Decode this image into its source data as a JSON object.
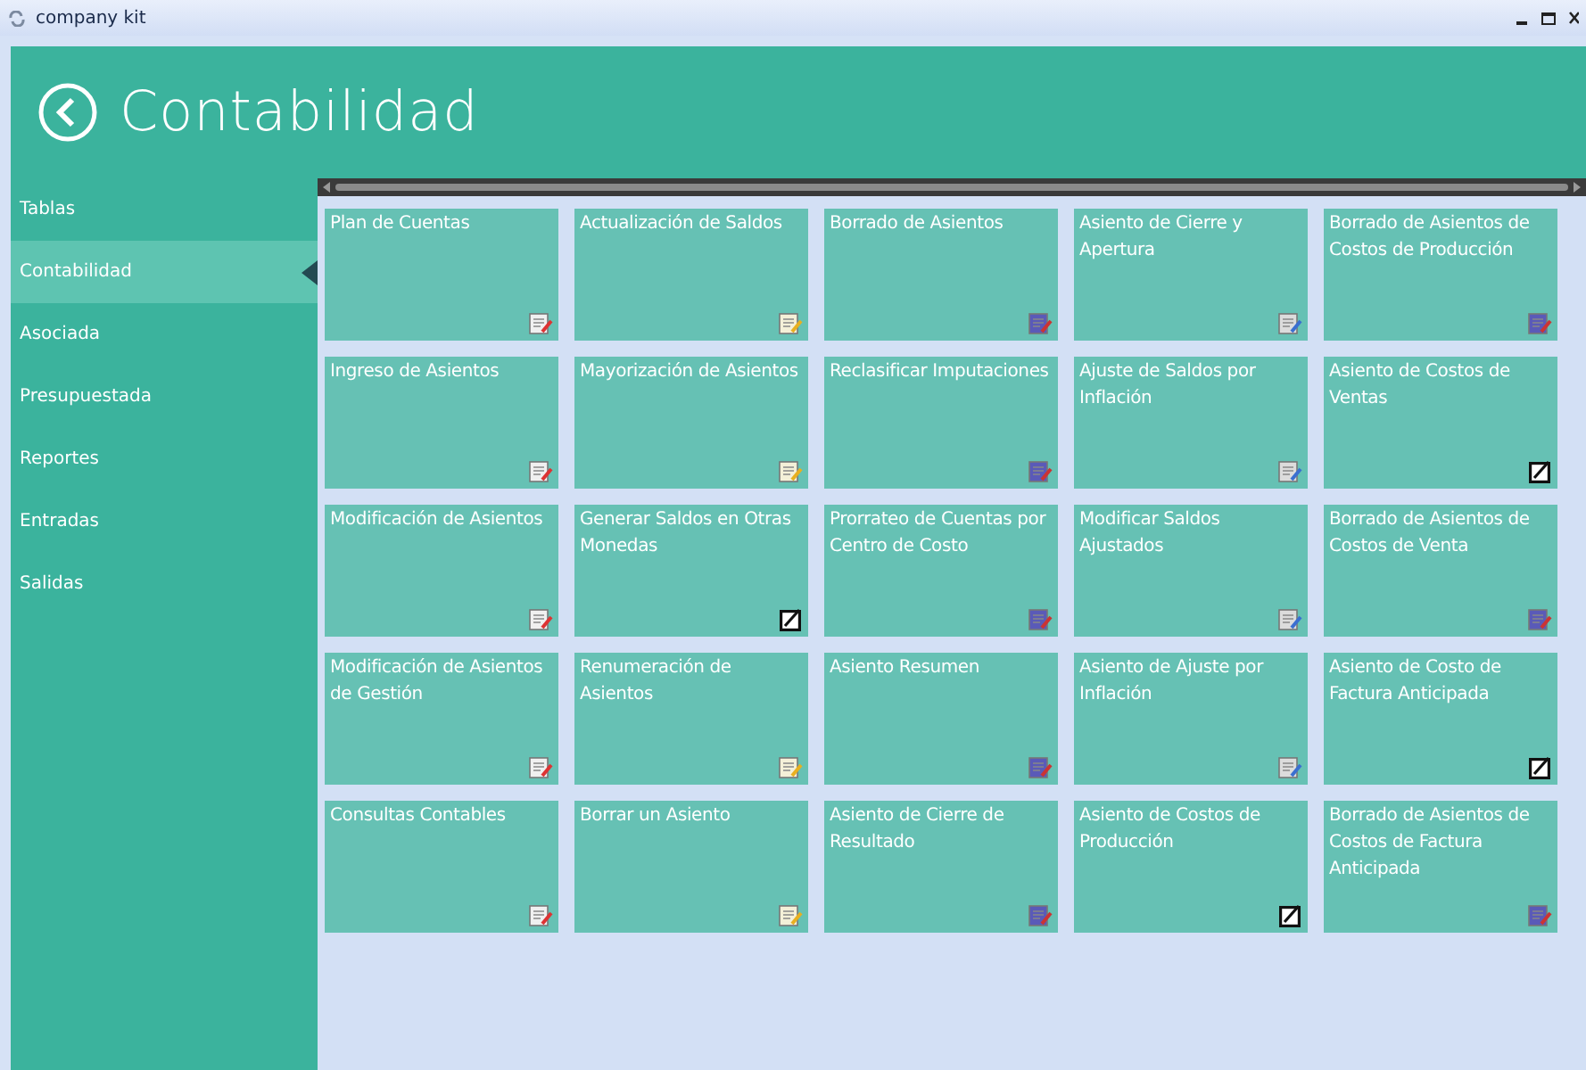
{
  "window": {
    "title": "company kit"
  },
  "header": {
    "title": "Contabilidad"
  },
  "sidebar": {
    "items": [
      {
        "label": "Tablas",
        "selected": false
      },
      {
        "label": "Contabilidad",
        "selected": true
      },
      {
        "label": "Asociada",
        "selected": false
      },
      {
        "label": "Presupuestada",
        "selected": false
      },
      {
        "label": "Reportes",
        "selected": false
      },
      {
        "label": "Entradas",
        "selected": false
      },
      {
        "label": "Salidas",
        "selected": false
      }
    ]
  },
  "tiles": [
    {
      "label": "Plan de Cuentas",
      "kind": "app"
    },
    {
      "label": "Actualización de Saldos",
      "kind": "app"
    },
    {
      "label": "Borrado de Asientos",
      "kind": "app"
    },
    {
      "label": "Asiento de Cierre y Apertura",
      "kind": "app"
    },
    {
      "label": "Borrado de Asientos de Costos de Producción",
      "kind": "app"
    },
    {
      "label": "Ingreso de Asientos",
      "kind": "app"
    },
    {
      "label": "Mayorización de Asientos",
      "kind": "app"
    },
    {
      "label": "Reclasificar Imputaciones",
      "kind": "app"
    },
    {
      "label": "Ajuste de Saldos por Inflación",
      "kind": "app"
    },
    {
      "label": "Asiento de Costos de Ventas",
      "kind": "edit"
    },
    {
      "label": "Modificación de Asientos",
      "kind": "app"
    },
    {
      "label": "Generar Saldos en Otras Monedas",
      "kind": "edit"
    },
    {
      "label": "Prorrateo de Cuentas por Centro de Costo",
      "kind": "app"
    },
    {
      "label": "Modificar Saldos Ajustados",
      "kind": "app"
    },
    {
      "label": "Borrado de Asientos de Costos de Venta",
      "kind": "app"
    },
    {
      "label": "Modificación de Asientos de Gestión",
      "kind": "app"
    },
    {
      "label": "Renumeración de Asientos",
      "kind": "app"
    },
    {
      "label": "Asiento Resumen",
      "kind": "app"
    },
    {
      "label": "Asiento de Ajuste por Inflación",
      "kind": "app"
    },
    {
      "label": "Asiento de Costo de Factura Anticipada",
      "kind": "edit"
    },
    {
      "label": "Consultas Contables",
      "kind": "app"
    },
    {
      "label": "Borrar un Asiento",
      "kind": "app"
    },
    {
      "label": "Asiento de Cierre de Resultado",
      "kind": "app"
    },
    {
      "label": "Asiento de Costos de Producción",
      "kind": "edit"
    },
    {
      "label": "Borrado de Asientos de Costos de Factura Anticipada",
      "kind": "app"
    }
  ]
}
